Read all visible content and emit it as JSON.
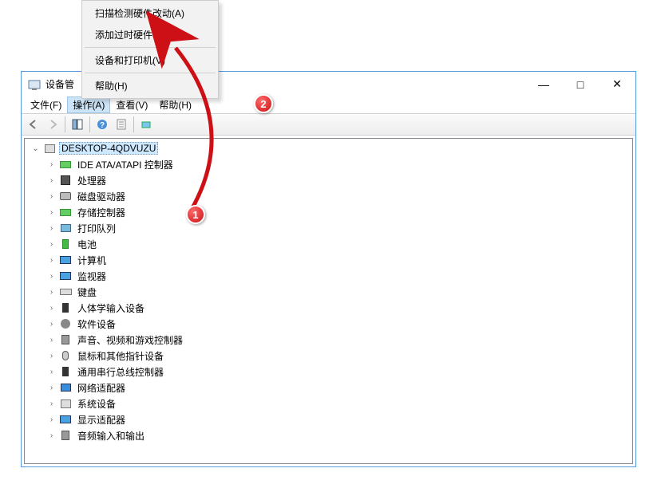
{
  "context_menu": {
    "items": [
      "扫描检测硬件改动(A)",
      "添加过时硬件(L)",
      "设备和打印机(V)",
      "帮助(H)"
    ]
  },
  "window": {
    "title": "设备管",
    "controls": {
      "min": "—",
      "max": "□",
      "close": "✕"
    }
  },
  "menubar": {
    "file": "文件(F)",
    "action": "操作(A)",
    "view": "查看(V)",
    "help": "帮助(H)"
  },
  "toolbar": {
    "back_icon": "arrow-left-icon",
    "forward_icon": "arrow-right-icon",
    "properties_icon": "properties-icon",
    "help_icon": "help-icon",
    "refresh_icon": "refresh-icon",
    "monitor_icon": "monitor-icon"
  },
  "tree": {
    "root": {
      "label": "DESKTOP-4QDVUZU",
      "icon": "pc-icon",
      "expanded": true,
      "selected": true
    },
    "children": [
      {
        "label": "IDE ATA/ATAPI 控制器",
        "icon": "card-icon"
      },
      {
        "label": "处理器",
        "icon": "chip-icon"
      },
      {
        "label": "磁盘驱动器",
        "icon": "disk-icon"
      },
      {
        "label": "存储控制器",
        "icon": "card-icon"
      },
      {
        "label": "打印队列",
        "icon": "printer-icon"
      },
      {
        "label": "电池",
        "icon": "battery-icon"
      },
      {
        "label": "计算机",
        "icon": "monitor-icon"
      },
      {
        "label": "监视器",
        "icon": "monitor-icon"
      },
      {
        "label": "键盘",
        "icon": "keyboard-icon"
      },
      {
        "label": "人体学输入设备",
        "icon": "usb-icon"
      },
      {
        "label": "软件设备",
        "icon": "gear-icon"
      },
      {
        "label": "声音、视频和游戏控制器",
        "icon": "speaker-icon"
      },
      {
        "label": "鼠标和其他指针设备",
        "icon": "mouse-icon"
      },
      {
        "label": "通用串行总线控制器",
        "icon": "usb-icon"
      },
      {
        "label": "网络适配器",
        "icon": "net-icon"
      },
      {
        "label": "系统设备",
        "icon": "pc-icon"
      },
      {
        "label": "显示适配器",
        "icon": "monitor-icon"
      },
      {
        "label": "音频输入和输出",
        "icon": "speaker-icon"
      }
    ]
  },
  "annotations": {
    "badge1": "1",
    "badge2": "2"
  }
}
